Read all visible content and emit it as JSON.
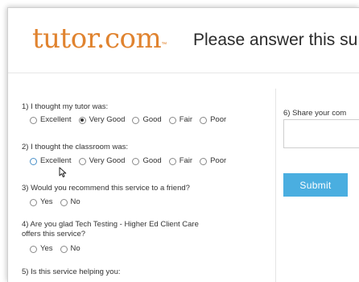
{
  "header": {
    "logo_text": "tutor.com",
    "logo_tm": "™",
    "title": "Please answer this su"
  },
  "questions": [
    {
      "label": "1) I thought my tutor was:",
      "options": [
        "Excellent",
        "Very Good",
        "Good",
        "Fair",
        "Poor"
      ],
      "selected": "Very Good"
    },
    {
      "label": "2) I thought the classroom was:",
      "options": [
        "Excellent",
        "Very Good",
        "Good",
        "Fair",
        "Poor"
      ],
      "selected": null
    },
    {
      "label": "3) Would you recommend this service to a friend?",
      "options": [
        "Yes",
        "No"
      ],
      "selected": null
    },
    {
      "label_line1": "4) Are you glad Tech Testing - Higher Ed Client Care",
      "label_line2": "offers this service?",
      "options": [
        "Yes",
        "No"
      ],
      "selected": null
    },
    {
      "label": "5) Is this service helping you:"
    }
  ],
  "side": {
    "q6_label": "6) Share your com",
    "submit_label": "Submit"
  },
  "colors": {
    "logo": "#e0832f",
    "submit_bg": "#4aaee0",
    "text": "#333333"
  }
}
